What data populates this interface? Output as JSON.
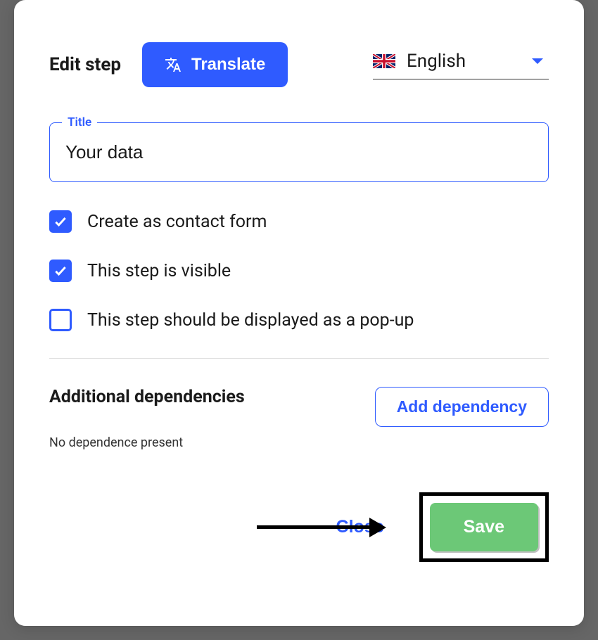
{
  "modal": {
    "title": "Edit step",
    "translate_label": "Translate",
    "language": {
      "name": "English",
      "flag": "uk"
    },
    "fields": {
      "title": {
        "label": "Title",
        "value": "Your data"
      }
    },
    "checkboxes": [
      {
        "label": "Create as contact form",
        "checked": true
      },
      {
        "label": "This step is visible",
        "checked": true
      },
      {
        "label": "This step should be displayed as a pop-up",
        "checked": false
      }
    ],
    "dependencies": {
      "heading": "Additional dependencies",
      "add_label": "Add dependency",
      "empty_text": "No dependence present"
    },
    "actions": {
      "close": "Close",
      "save": "Save"
    }
  }
}
